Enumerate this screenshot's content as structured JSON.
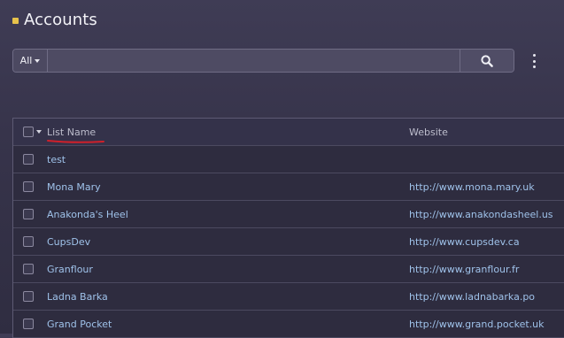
{
  "header": {
    "title": "Accounts"
  },
  "search": {
    "scope_label": "All",
    "value": "",
    "placeholder": ""
  },
  "table": {
    "columns": [
      "List Name",
      "Website"
    ],
    "rows": [
      {
        "name": "test",
        "website": ""
      },
      {
        "name": "Mona Mary",
        "website": "http://www.mona.mary.uk"
      },
      {
        "name": "Anakonda's Heel",
        "website": "http://www.anakondasheel.us"
      },
      {
        "name": "CupsDev",
        "website": "http://www.cupsdev.ca"
      },
      {
        "name": "Granflour",
        "website": "http://www.granflour.fr"
      },
      {
        "name": "Ladna Barka",
        "website": "http://www.ladnabarka.po"
      },
      {
        "name": "Grand Pocket",
        "website": "http://www.grand.pocket.uk"
      }
    ]
  },
  "icons": {
    "title_marker": "square-marker-icon",
    "scope_caret": "chevron-down-icon",
    "search": "search-icon",
    "more": "kebab-menu-icon"
  },
  "colors": {
    "accent": "#e7c24b",
    "link": "#9fc2ea",
    "annotation": "#d0202a"
  }
}
